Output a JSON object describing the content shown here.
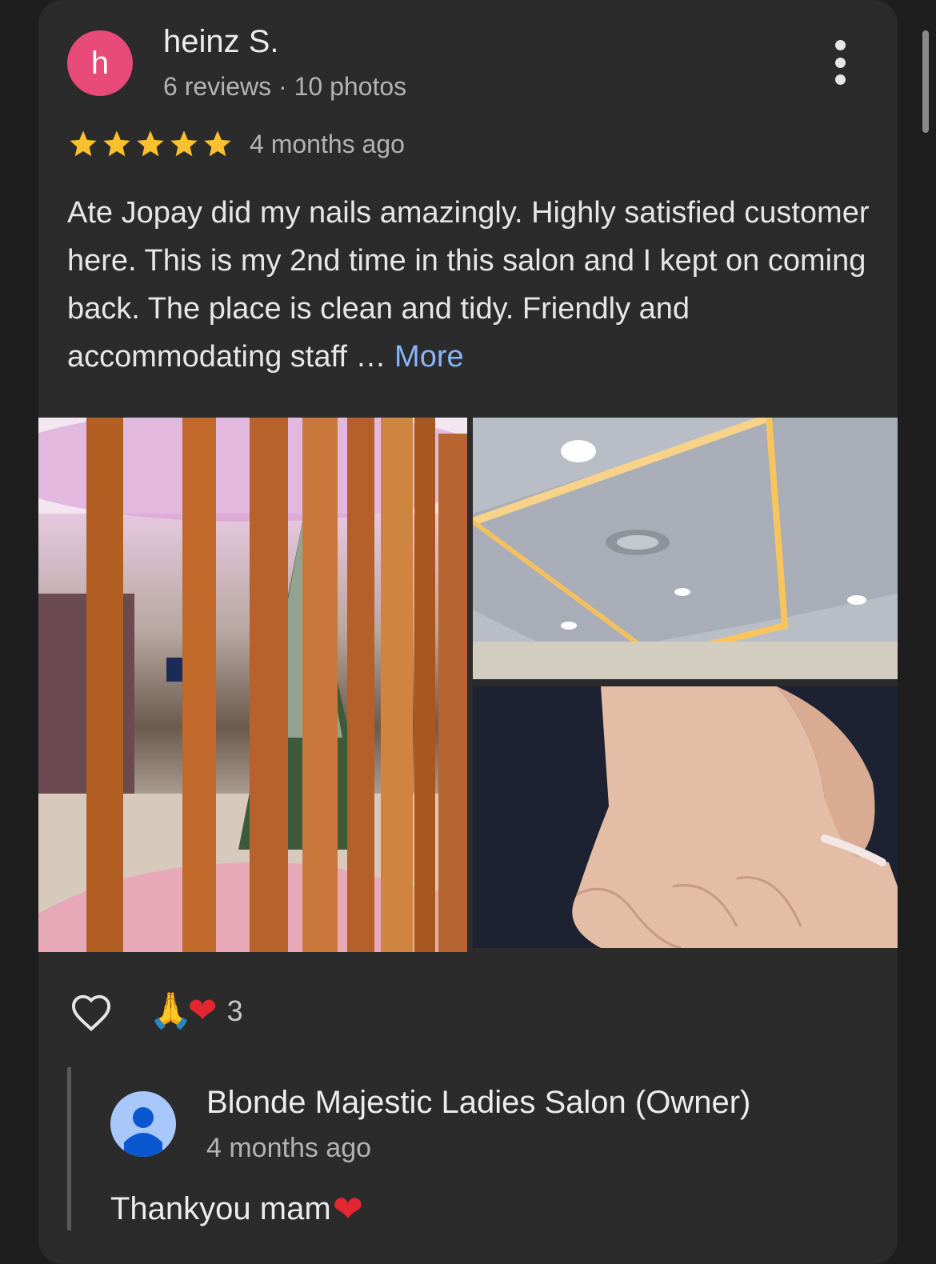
{
  "review": {
    "author_initial": "h",
    "author_name": "heinz S.",
    "author_meta": "6 reviews · 10 photos",
    "rating": 5,
    "time": "4 months ago",
    "text": "Ate Jopay did my nails amazingly. Highly satisfied customer here. This is my 2nd time in this salon and I kept on coming back. The place is clean and tidy. Friendly and accommodating staff … ",
    "more_label": "More",
    "reaction_count": "3",
    "reaction_emojis": [
      "🙏",
      "❤"
    ]
  },
  "reply": {
    "owner_name": "Blonde Majestic Ladies Salon (Owner)",
    "time": "4 months ago",
    "text": "Thankyou mam",
    "emoji": "❤"
  },
  "colors": {
    "avatar": "#e84a79",
    "star": "#fbc02d",
    "link": "#8ab4f8",
    "heart": "#e3262f"
  },
  "icons": [
    "more-vert-icon",
    "star-icon",
    "heart-outline-icon",
    "owner-person-icon"
  ]
}
